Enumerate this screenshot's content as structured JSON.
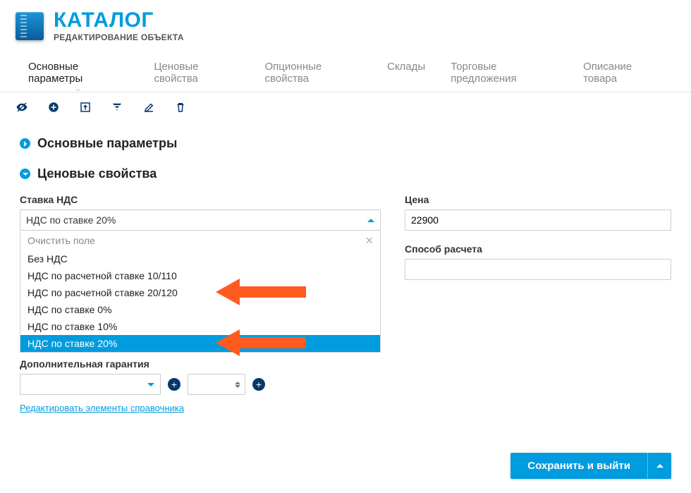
{
  "header": {
    "title": "КАТАЛОГ",
    "subtitle": "РЕДАКТИРОВАНИЕ ОБЪЕКТА"
  },
  "tabs": {
    "items": [
      "Основные параметры",
      "Ценовые свойства",
      "Опционные свойства",
      "Склады",
      "Торговые предложения",
      "Описание товара"
    ],
    "active_index": 0
  },
  "sections": {
    "basic": "Основные параметры",
    "price": "Ценовые свойства"
  },
  "fields": {
    "vat_label": "Ставка НДС",
    "vat_value": "НДС по ставке 20%",
    "vat_clear": "Очистить поле",
    "vat_options": [
      "Без НДС",
      "НДС по расчетной ставке 10/110",
      "НДС по расчетной ставке 20/120",
      "НДС по ставке 0%",
      "НДС по ставке 10%",
      "НДС по ставке 20%"
    ],
    "vat_selected_index": 5,
    "price_label": "Цена",
    "price_value": "22900",
    "method_label": "Способ расчета",
    "method_value": "",
    "extra_warranty_label": "Дополнительная гарантия",
    "ref_link": "Редактировать элементы справочника"
  },
  "footer": {
    "save_label": "Сохранить и выйти"
  },
  "icons": {
    "hide": "visibility-off-icon",
    "add": "plus-circle-icon",
    "archive": "archive-icon",
    "filter": "filter-icon",
    "edit": "edit-icon",
    "trash": "trash-icon"
  },
  "colors": {
    "accent": "#009cde",
    "annotation": "#ff5a1f"
  }
}
